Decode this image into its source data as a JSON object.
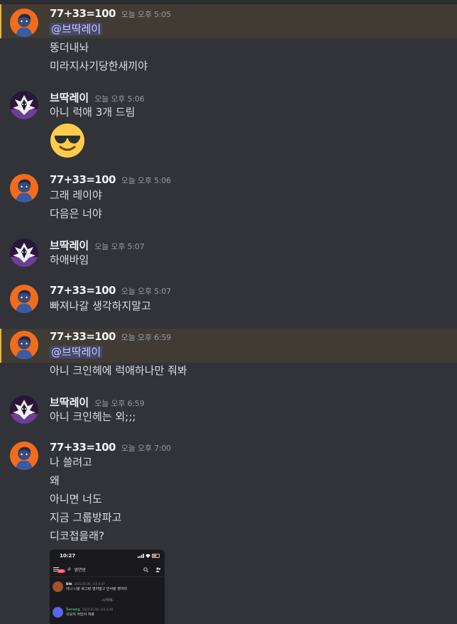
{
  "channel": {
    "messages": [
      {
        "user": "77+33=100",
        "time": "오늘 오후 5:05",
        "mention": "@브딱레이",
        "lines": [
          "뚱더내놔",
          "미라지사기당한새끼야"
        ]
      },
      {
        "user": "브딱레이",
        "time": "오늘 오후 5:06",
        "lines": [
          "아니 럭애 3개 드림"
        ],
        "emoji": "sunglasses-emoji"
      },
      {
        "user": "77+33=100",
        "time": "오늘 오후 5:06",
        "lines": [
          "그래 레이야",
          "다음은 너야"
        ]
      },
      {
        "user": "브딱레이",
        "time": "오늘 오후 5:07",
        "lines": [
          "하애바임"
        ]
      },
      {
        "user": "77+33=100",
        "time": "오늘 오후 5:07",
        "lines": [
          "빠져나갈 생각하지말고"
        ]
      },
      {
        "user": "77+33=100",
        "time": "오늘 오후 6:59",
        "mention": "@브딱레이",
        "lines": [
          "아니 크인헤에 럭애하나만 줘봐"
        ]
      },
      {
        "user": "브딱레이",
        "time": "오늘 오후 6:59",
        "lines": [
          "아니 크인헤는 외;;;"
        ]
      },
      {
        "user": "77+33=100",
        "time": "오늘 오후 7:00",
        "lines": [
          "나 쓸려고",
          "왜",
          "아니면 너도",
          "지금 그룹방파고",
          "디코접을래?"
        ]
      }
    ]
  },
  "attachment": {
    "clock": "10:27",
    "channel_name": "영연방",
    "badge": "105",
    "messages": [
      {
        "name": "ble",
        "time": "2023.05.08. 오후 6:47",
        "text": "아니 나랑 호그랑 영지말고 민서랑 영어라",
        "color": "#a0522d"
      },
      {
        "name": "Serang",
        "time": "2023.05.08. 오후 6:48",
        "text": "이모지 어딨어 쳐봐",
        "color": "#5865f2"
      }
    ],
    "system_text": "-시작해-"
  },
  "colors": {
    "background": "#313338",
    "highlight": "#403c33",
    "mention_bg": "#3c4270",
    "orange_avatar": "#f26c1c",
    "purple_avatar": "#6b3f9a"
  }
}
